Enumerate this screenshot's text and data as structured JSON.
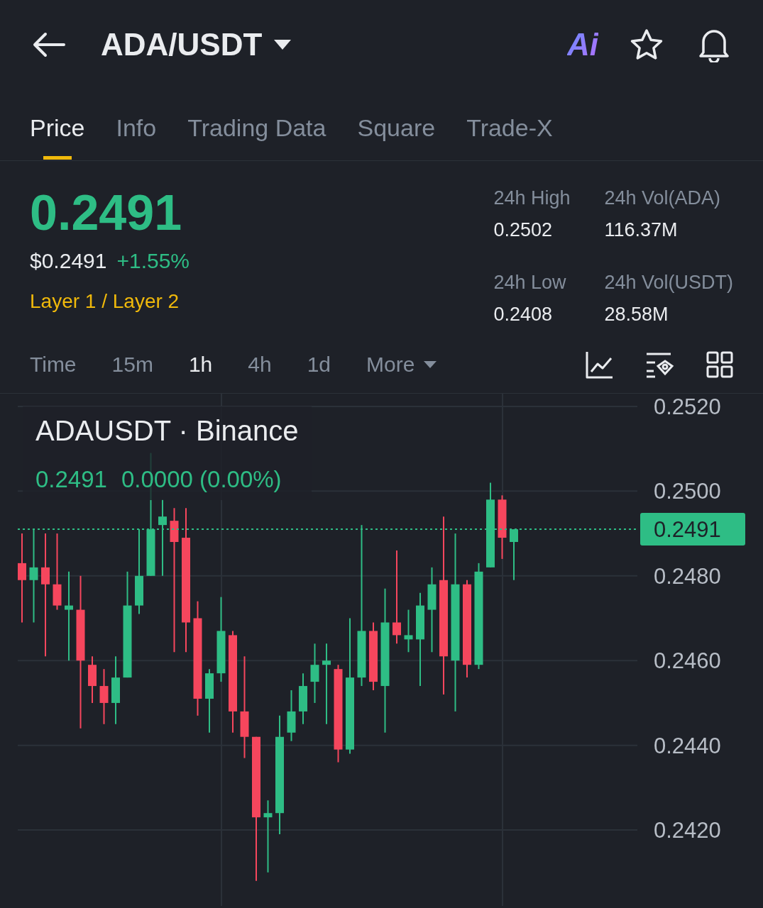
{
  "header": {
    "pair": "ADA/USDT",
    "ai_label": "Ai"
  },
  "tabs": [
    {
      "label": "Price",
      "selected": true
    },
    {
      "label": "Info",
      "selected": false
    },
    {
      "label": "Trading Data",
      "selected": false
    },
    {
      "label": "Square",
      "selected": false
    },
    {
      "label": "Trade-X",
      "selected": false
    }
  ],
  "price": {
    "last": "0.2491",
    "usd": "$0.2491",
    "change": "+1.55%",
    "category": "Layer 1 / Layer 2"
  },
  "stats": [
    {
      "label": "24h High",
      "value": "0.2502"
    },
    {
      "label": "24h Vol(ADA)",
      "value": "116.37M"
    },
    {
      "label": "24h Low",
      "value": "0.2408"
    },
    {
      "label": "24h Vol(USDT)",
      "value": "28.58M"
    }
  ],
  "intervals": [
    {
      "label": "Time",
      "selected": false,
      "kind": "option"
    },
    {
      "label": "15m",
      "selected": false,
      "kind": "option"
    },
    {
      "label": "1h",
      "selected": true,
      "kind": "option"
    },
    {
      "label": "4h",
      "selected": false,
      "kind": "option"
    },
    {
      "label": "1d",
      "selected": false,
      "kind": "option"
    },
    {
      "label": "More",
      "selected": false,
      "kind": "dropdown"
    }
  ],
  "chart": {
    "title": "ADAUSDT · Binance",
    "legend_price": "0.2491",
    "legend_change": "0.0000 (0.00%)",
    "price_tag": "0.2491",
    "price_axis": [
      "0.2520",
      "0.2500",
      "0.2480",
      "0.2460",
      "0.2440",
      "0.2420"
    ]
  }
}
